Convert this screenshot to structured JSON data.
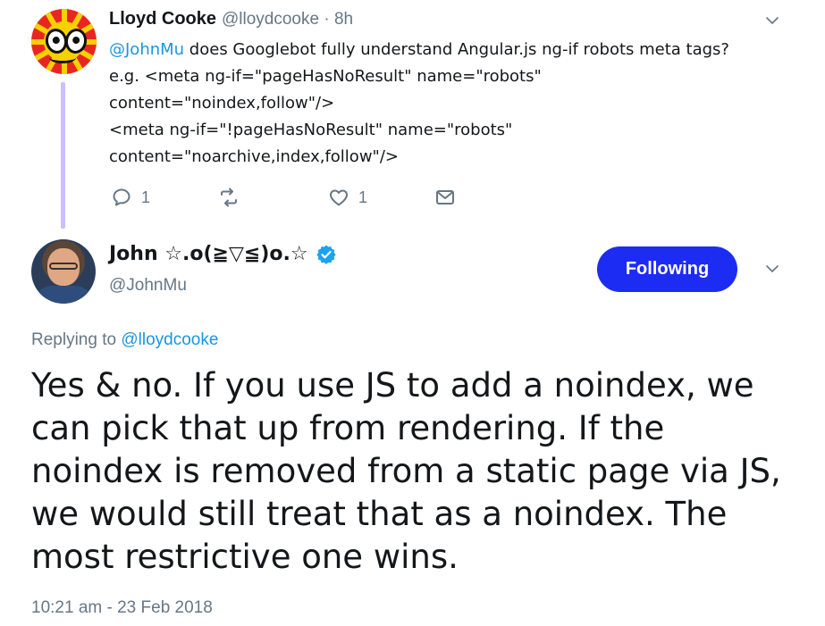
{
  "parent_tweet": {
    "display_name": "Lloyd Cooke",
    "handle_time": "@lloydcooke · 8h",
    "lines": [
      {
        "mention": "@JohnMu",
        "text": " does Googlebot fully understand Angular.js ng-if robots meta tags?"
      },
      {
        "mention": "",
        "text": "e.g. <meta ng-if=\"pageHasNoResult\" name=\"robots\""
      },
      {
        "mention": "",
        "text": "content=\"noindex,follow\"/>"
      },
      {
        "mention": "",
        "text": "<meta ng-if=\"!pageHasNoResult\" name=\"robots\""
      },
      {
        "mention": "",
        "text": "content=\"noarchive,index,follow\"/>"
      }
    ],
    "actions": {
      "reply_count": "1",
      "retweet_count": "",
      "like_count": "1"
    }
  },
  "reply_tweet": {
    "display_name": "John ☆.o(≧▽≦)o.☆",
    "handle": "@JohnMu",
    "follow_label": "Following",
    "replying_prefix": "Replying to ",
    "replying_to": "@lloydcooke",
    "lines": [
      "Yes & no. If you use JS to add a noindex, we",
      "can pick that up from rendering. If the",
      "noindex is removed from a static page via JS,",
      "we would still treat that as a noindex. The",
      "most restrictive one wins."
    ],
    "timestamp": "10:21 am - 23 Feb 2018"
  },
  "colors": {
    "link": "#1b95e0",
    "follow_button": "#1d2cf3",
    "muted": "#657786",
    "thread_line": "#cdbfff"
  },
  "icons": [
    "chevron-down-icon",
    "reply-icon",
    "retweet-icon",
    "like-icon",
    "message-icon",
    "verified-badge-icon"
  ]
}
